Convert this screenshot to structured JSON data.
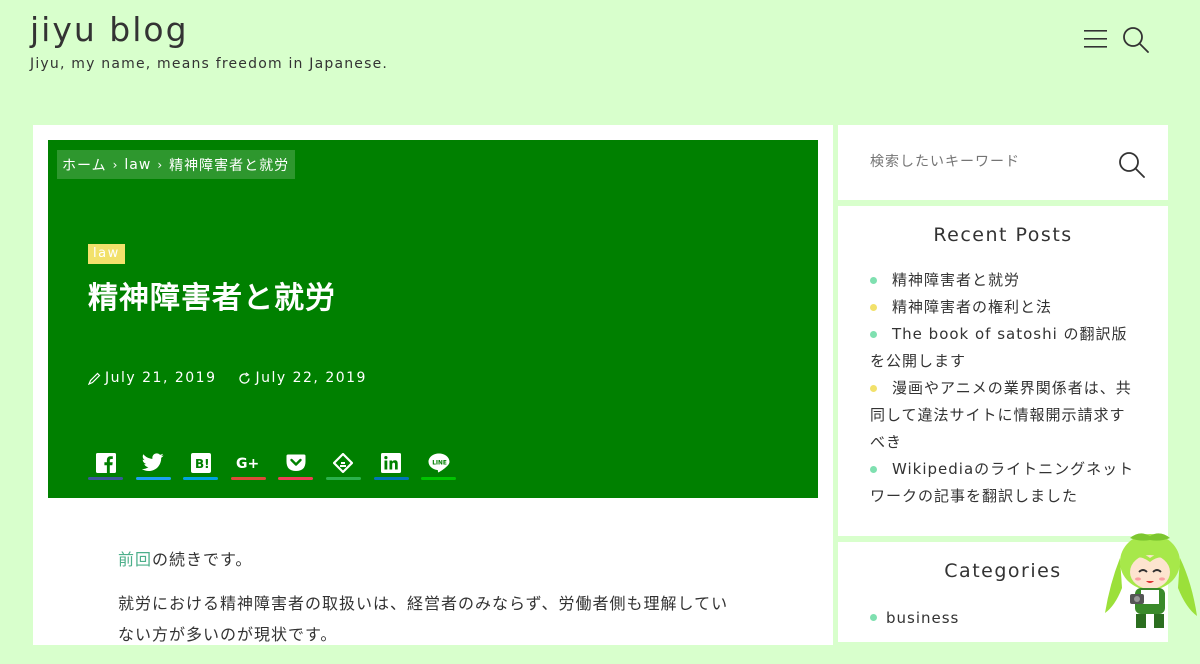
{
  "site": {
    "title": "jiyu blog",
    "description": "Jiyu, my name, means freedom in Japanese."
  },
  "header": {
    "menu_icon": "menu-icon",
    "search_icon": "search-icon"
  },
  "breadcrumb": {
    "home": "ホーム",
    "category": "law",
    "current": "精神障害者と就労"
  },
  "post": {
    "category": "law",
    "title": "精神障害者と就労",
    "published": "July 21, 2019",
    "updated": "July 22, 2019",
    "content": {
      "p1_link": "前回",
      "p1_text": "の続きです。",
      "p2_text": "就労における精神障害者の取扱いは、経営者のみならず、労働者側も理解してい",
      "p2_cont": "ない方が多いのが現状です。"
    }
  },
  "share": [
    {
      "name": "facebook",
      "icon": "facebook-icon",
      "color": "#3b5998"
    },
    {
      "name": "twitter",
      "icon": "twitter-icon",
      "color": "#1da1f2"
    },
    {
      "name": "hatena",
      "icon": "hatena-bookmark-icon",
      "color": "#00a4de"
    },
    {
      "name": "google-plus",
      "icon": "google-plus-icon",
      "color": "#dd4b39"
    },
    {
      "name": "pocket",
      "icon": "pocket-icon",
      "color": "#ef4056"
    },
    {
      "name": "feedly",
      "icon": "feedly-icon",
      "color": "#2bb24c"
    },
    {
      "name": "linkedin",
      "icon": "linkedin-icon",
      "color": "#0077b5"
    },
    {
      "name": "line",
      "icon": "line-icon",
      "color": "#00c300"
    }
  ],
  "sidebar": {
    "search_placeholder": "検索したいキーワード",
    "recent_title": "Recent Posts",
    "recent_posts": [
      {
        "title": "精神障害者と就労",
        "dot": "#7fe0b0"
      },
      {
        "title": "精神障害者の権利と法",
        "dot": "#f2e16b"
      },
      {
        "title": "The book of satoshi の翻訳版を公開します",
        "dot": "#7fe0b0"
      },
      {
        "title": "漫画やアニメの業界関係者は、共同して違法サイトに情報開示請求すべき",
        "dot": "#f2e16b"
      },
      {
        "title": "Wikipediaのライトニングネットワークの記事を翻訳しました",
        "dot": "#7fe0b0"
      }
    ],
    "categories_title": "Categories",
    "categories": [
      {
        "name": "business",
        "dot": "#7fe0b0"
      }
    ]
  },
  "colors": {
    "background": "#d8ffcc",
    "hero": "#008000",
    "accent_green": "#7fe0b0",
    "accent_yellow": "#f2e16b"
  }
}
